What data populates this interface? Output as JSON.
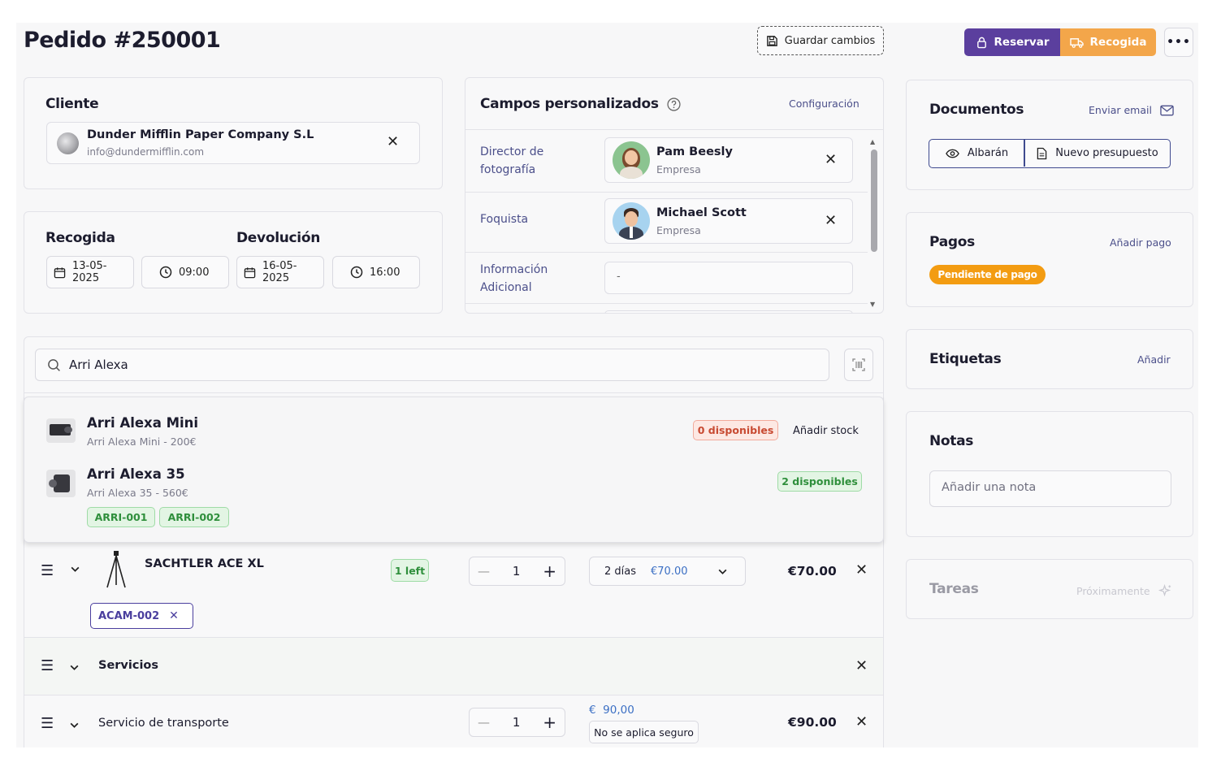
{
  "order": {
    "title": "Pedido #250001",
    "save_label": "Guardar cambios",
    "reserve_label": "Reservar",
    "pickup_label": "Recogida",
    "more_icon": "more-dots-icon"
  },
  "customer": {
    "heading": "Cliente",
    "name": "Dunder Mifflin Paper Company S.L",
    "email": "info@dundermifflin.com"
  },
  "dates": {
    "pickup_heading": "Recogida",
    "pickup_date": "13-05-2025",
    "pickup_time": "09:00",
    "return_heading": "Devolución",
    "return_date": "16-05-2025",
    "return_time": "16:00"
  },
  "custom_fields": {
    "heading": "Campos personalizados",
    "config_label": "Configuración",
    "fields": [
      {
        "label": "Director de fotografía",
        "person": "Pam Beesly",
        "role": "Empresa"
      },
      {
        "label": "Foquista",
        "person": "Michael Scott",
        "role": "Empresa"
      },
      {
        "label": "Información Adicional",
        "value": "-"
      }
    ]
  },
  "search": {
    "value": "Arri Alexa"
  },
  "results": [
    {
      "name": "Arri Alexa Mini",
      "sub": "Arri Alexa Mini - 200€",
      "availability": "0 disponibles",
      "action": "Añadir stock"
    },
    {
      "name": "Arri Alexa 35",
      "sub": "Arri Alexa 35 - 560€",
      "availability": "2 disponibles",
      "tags": [
        "ARRI-001",
        "ARRI-002"
      ]
    }
  ],
  "lines": {
    "item": {
      "name": "SACHTLER ACE XL",
      "badge": "1 left",
      "qty": "1",
      "days": "2 días",
      "day_price": "€70.00",
      "total": "€70.00",
      "tag": "ACAM-002"
    },
    "services_heading": "Servicios",
    "service": {
      "name": "Servicio de transporte",
      "qty": "1",
      "price": "€  90,00",
      "insurance": "No se aplica seguro",
      "total": "€90.00"
    }
  },
  "documents": {
    "heading": "Documentos",
    "email_label": "Enviar email",
    "delivery_label": "Albarán",
    "quote_label": "Nuevo presupuesto"
  },
  "payments": {
    "heading": "Pagos",
    "add_label": "Añadir pago",
    "status": "Pendiente de pago"
  },
  "labels": {
    "heading": "Etiquetas",
    "add_label": "Añadir"
  },
  "notes": {
    "heading": "Notas",
    "placeholder": "Añadir una nota"
  },
  "tasks": {
    "heading": "Tareas",
    "soon_label": "Próximamente"
  },
  "colors": {
    "primary": "#5b3f9e",
    "pickup": "#f3a64a",
    "link": "#4b4f8a",
    "pending": "#f39c12"
  }
}
